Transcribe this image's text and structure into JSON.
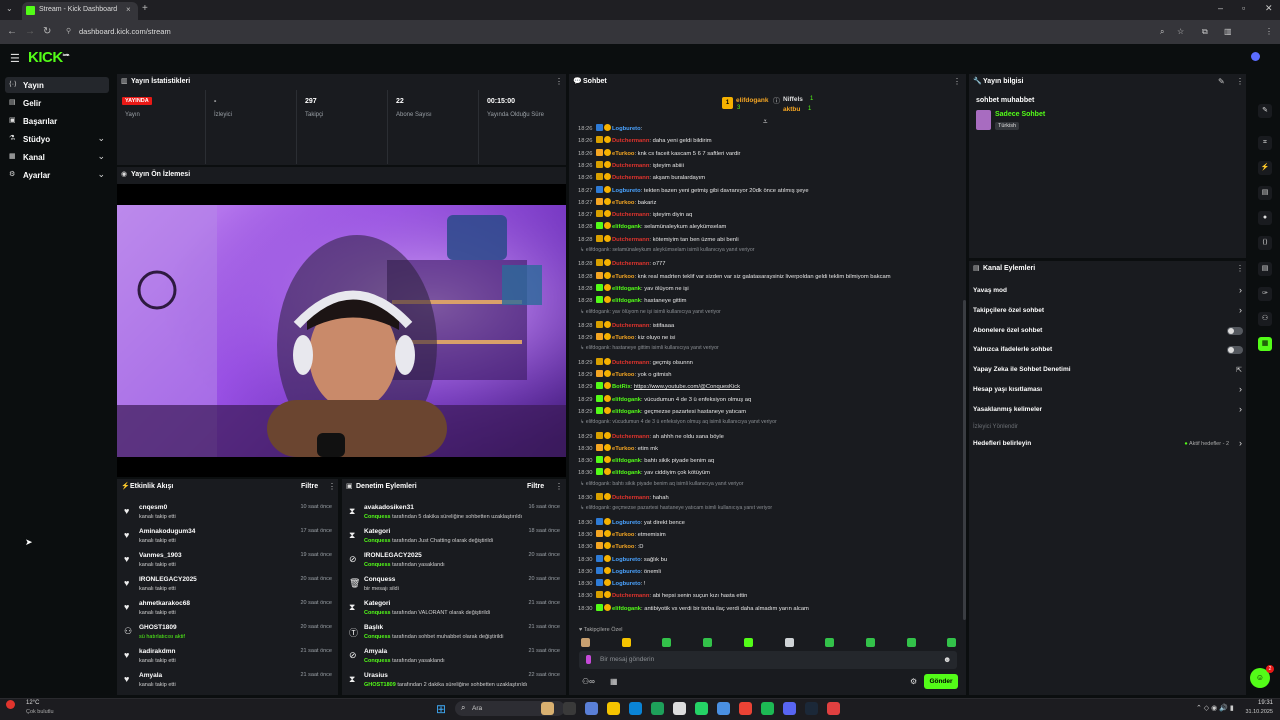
{
  "browser": {
    "tab_title": "Stream - Kick Dashboard",
    "url": "dashboard.kick.com/stream"
  },
  "logo": "KICK",
  "sidebar": {
    "items": [
      {
        "label": "Yayın",
        "icon": "broadcast-icon",
        "active": true,
        "chevron": false
      },
      {
        "label": "Gelir",
        "icon": "revenue-icon",
        "active": false,
        "chevron": false
      },
      {
        "label": "Başarılar",
        "icon": "achievements-icon",
        "active": false,
        "chevron": false
      },
      {
        "label": "Stüdyo",
        "icon": "studio-icon",
        "active": false,
        "chevron": true
      },
      {
        "label": "Kanal",
        "icon": "channel-icon",
        "active": false,
        "chevron": true
      },
      {
        "label": "Ayarlar",
        "icon": "settings-icon",
        "active": false,
        "chevron": true
      }
    ]
  },
  "stats": {
    "title": "Yayın İstatistikleri",
    "live_badge": "YAYINDA",
    "items": [
      {
        "value": "",
        "label": "Yayın"
      },
      {
        "value": "-",
        "label": "İzleyici"
      },
      {
        "value": "297",
        "label": "Takipçi"
      },
      {
        "value": "22",
        "label": "Abone Sayısı"
      },
      {
        "value": "00:15:00",
        "label": "Yayında Olduğu Süre"
      }
    ]
  },
  "preview": {
    "title": "Yayın Ön İzlemesi"
  },
  "activity": {
    "title": "Etkinlik Akışı",
    "filter": "Filtre",
    "rows": [
      {
        "icon": "heart-icon",
        "name": "cnqesm0",
        "sub": "kanalı takip etti",
        "time": "10 saat önce"
      },
      {
        "icon": "heart-icon",
        "name": "Aminakodugum34",
        "sub": "kanalı takip etti",
        "time": "17 saat önce"
      },
      {
        "icon": "heart-icon",
        "name": "Vanmes_1903",
        "sub": "kanalı takip etti",
        "time": "19 saat önce"
      },
      {
        "icon": "heart-icon",
        "name": "IRONLEGACY2025",
        "sub": "kanalı takip etti",
        "time": "20 saat önce"
      },
      {
        "icon": "heart-icon",
        "name": "ahmetkarakoc68",
        "sub": "kanalı takip etti",
        "time": "20 saat önce"
      },
      {
        "icon": "gift-icon",
        "name": "GHOST1809",
        "sub": "sü hatırlatıcısı aktif",
        "time": "20 saat önce"
      },
      {
        "icon": "heart-icon",
        "name": "kadirakdmn",
        "sub": "kanalı takip etti",
        "time": "21 saat önce"
      },
      {
        "icon": "heart-icon",
        "name": "Amyala",
        "sub": "kanalı takip etti",
        "time": "21 saat önce"
      }
    ]
  },
  "moderation": {
    "title": "Denetim Eylemleri",
    "filter": "Filtre",
    "rows": [
      {
        "icon": "hourglass-icon",
        "name": "avakadosiken31",
        "who": "Conquess",
        "sub": " tarafından 5 dakika süreliğine sohbetten uzaklaştırıldı",
        "time": "16 saat önce"
      },
      {
        "icon": "hourglass-icon",
        "name": "Kategori",
        "who": "Conquess",
        "sub": " tarafından Just Chatting olarak değiştirildi",
        "time": "18 saat önce"
      },
      {
        "icon": "ban-icon",
        "name": "IRONLEGACY2025",
        "who": "Conquess",
        "sub": " tarafından yasaklandı",
        "time": "20 saat önce"
      },
      {
        "icon": "trash-icon",
        "name": "Conquess",
        "who": "",
        "sub": "bir mesajı sildi",
        "time": "20 saat önce"
      },
      {
        "icon": "hourglass-icon",
        "name": "Kategori",
        "who": "Conquess",
        "sub": " tarafından VALORANT olarak değiştirildi",
        "time": "21 saat önce"
      },
      {
        "icon": "title-icon",
        "name": "Başlık",
        "who": "Conquess",
        "sub": " tarafından sohbet muhabbet olarak değiştirildi",
        "time": "21 saat önce"
      },
      {
        "icon": "ban-icon",
        "name": "Amyala",
        "who": "Conquess",
        "sub": " tarafından yasaklandı",
        "time": "21 saat önce"
      },
      {
        "icon": "hourglass-icon",
        "name": "Urasius",
        "who": "GHOST1809",
        "sub": " tarafından 2 dakika süreliğine sohbetten uzaklaştırıldı",
        "time": "22 saat önce"
      }
    ]
  },
  "chat": {
    "title": "Sohbet",
    "leaders": [
      {
        "name": "elifdogank",
        "count": "3"
      },
      {
        "name": "Niffels",
        "count": "1"
      },
      {
        "name": "aktbu",
        "count": "1"
      }
    ],
    "messages": [
      {
        "t": "18:26",
        "u": "Logbureto",
        "c": "#4aa3ff",
        "x": ""
      },
      {
        "t": "18:26",
        "u": "Dutchermann",
        "c": "#e0342d",
        "x": "daha yeni geldi bildirim"
      },
      {
        "t": "18:26",
        "u": "eTurkoo",
        "c": "#f5a623",
        "x": "knk cs faceit kascam 5 6 7 saftleri vardir"
      },
      {
        "t": "18:26",
        "u": "Dutchermann",
        "c": "#e0342d",
        "x": "işteyim abiiii"
      },
      {
        "t": "18:26",
        "u": "Dutchermann",
        "c": "#e0342d",
        "x": "akşam buralardayım"
      },
      {
        "t": "18:27",
        "u": "Logbureto",
        "c": "#4aa3ff",
        "x": "tekten bazen yeni getmiş gibi davranıyor 20dk önce atılmış şeye"
      },
      {
        "t": "18:27",
        "u": "eTurkoo",
        "c": "#f5a623",
        "x": "bakariz"
      },
      {
        "t": "18:27",
        "u": "Dutchermann",
        "c": "#e0342d",
        "x": "işteyim diyin aq"
      },
      {
        "t": "18:28",
        "u": "elifdogank",
        "c": "#53fc18",
        "x": "selamünaleykum aleykümselam"
      },
      {
        "t": "18:28",
        "u": "Dutchermann",
        "c": "#e0342d",
        "x": "kötemiyim tan ben üzme abi benli"
      },
      {
        "reply": "elifdogank: selamünaleykum aleykümselam isimli kullanıcıya yanıt veriyor"
      },
      {
        "t": "18:28",
        "u": "Dutchermann",
        "c": "#e0342d",
        "x": "o777"
      },
      {
        "t": "18:28",
        "u": "eTurkoo",
        "c": "#f5a623",
        "x": "knk real madrten teklif var sizden var siz galatasaraysiniz liverpoldan geldi teklim bilmiyom bakcam"
      },
      {
        "t": "18:28",
        "u": "elifdogank",
        "c": "#53fc18",
        "x": "yav ölüyom ne işi"
      },
      {
        "t": "18:28",
        "u": "elifdogank",
        "c": "#53fc18",
        "x": "hastaneye gittim"
      },
      {
        "reply": "elifdogank: yav ölüyom ne işi isimli kullanıcıya yanıt veriyor"
      },
      {
        "t": "18:28",
        "u": "Dutchermann",
        "c": "#e0342d",
        "x": "istifaaaa"
      },
      {
        "t": "18:29",
        "u": "eTurkoo",
        "c": "#f5a623",
        "x": "kiz oluyo ne isi"
      },
      {
        "reply": "elifdogank: hastaneye gittim isimli kullanıcıya yanıt veriyor"
      },
      {
        "t": "18:29",
        "u": "Dutchermann",
        "c": "#e0342d",
        "x": "geçmiş olsunnn"
      },
      {
        "t": "18:29",
        "u": "eTurkoo",
        "c": "#f5a623",
        "x": "yok o gitmish"
      },
      {
        "t": "18:29",
        "u": "BotRix",
        "c": "#53fc18",
        "x": "https://www.youtube.com/@ConquesKick"
      },
      {
        "t": "18:29",
        "u": "elifdogank",
        "c": "#53fc18",
        "x": "vücudumun 4 de 3 ü enfeksiyon olmuş aq"
      },
      {
        "t": "18:29",
        "u": "elifdogank",
        "c": "#53fc18",
        "x": "geçmezse pazartesi hastaneye yatıcam"
      },
      {
        "reply": "elifdogank: vücudumun 4 de 3 ü enfeksiyon olmuş aq isimli kullanıcıya yanıt veriyor"
      },
      {
        "t": "18:29",
        "u": "Dutchermann",
        "c": "#e0342d",
        "x": "ah ahhh ne oldu sana böyle"
      },
      {
        "t": "18:30",
        "u": "eTurkoo",
        "c": "#f5a623",
        "x": "etim mk"
      },
      {
        "t": "18:30",
        "u": "elifdogank",
        "c": "#53fc18",
        "x": "bahtı sikik piyade benim aq"
      },
      {
        "t": "18:30",
        "u": "elifdogank",
        "c": "#53fc18",
        "x": "yav ciddiyim çok kötüyüm"
      },
      {
        "reply": "elifdogank: bahtı sikik piyade benim aq isimli kullanıcıya yanıt veriyor"
      },
      {
        "t": "18:30",
        "u": "Dutchermann",
        "c": "#e0342d",
        "x": "hahah"
      },
      {
        "reply": "elifdogank: geçmezse pazartesi hastaneye yatıcam isimli kullanıcıya yanıt veriyor"
      },
      {
        "t": "18:30",
        "u": "Logbureto",
        "c": "#4aa3ff",
        "x": "yat direkt bence"
      },
      {
        "t": "18:30",
        "u": "eTurkoo",
        "c": "#f5a623",
        "x": "etmemisim"
      },
      {
        "t": "18:30",
        "u": "eTurkoo",
        "c": "#f5a623",
        "x": ":D"
      },
      {
        "t": "18:30",
        "u": "Logbureto",
        "c": "#4aa3ff",
        "x": "sağlık bu"
      },
      {
        "t": "18:30",
        "u": "Logbureto",
        "c": "#4aa3ff",
        "x": "önemli"
      },
      {
        "t": "18:30",
        "u": "Logbureto",
        "c": "#4aa3ff",
        "x": "!"
      },
      {
        "t": "18:30",
        "u": "Dutchermann",
        "c": "#e0342d",
        "x": "abi hepsi senin suçun kızı hasta ettin"
      },
      {
        "t": "18:30",
        "u": "elifdogank",
        "c": "#53fc18",
        "x": "antibiyotik vs verdi bir torba ilaç verdi daha almadım yarın alcam"
      }
    ],
    "followers_only": "Takipçilere Özel",
    "input_placeholder": "Bir mesaj gönderin",
    "send": "Gönder"
  },
  "stream_info": {
    "title": "Yayın bilgisi",
    "stream_title": "sohbet muhabbet",
    "category": "Sadece Sohbet",
    "tag": "Türkish"
  },
  "channel_actions": {
    "title": "Kanal Eylemleri",
    "items": [
      {
        "label": "Yavaş mod",
        "kind": "chevron"
      },
      {
        "label": "Takipçilere özel sohbet",
        "kind": "chevron"
      },
      {
        "label": "Abonelere özel sohbet",
        "kind": "toggle"
      },
      {
        "label": "Yalnızca ifadelerle sohbet",
        "kind": "toggle"
      },
      {
        "label": "Yapay Zeka ile Sohbet Denetimi",
        "kind": "external"
      },
      {
        "label": "Hesap yaşı kısıtlaması",
        "kind": "chevron"
      },
      {
        "label": "Yasaklanmış kelimeler",
        "kind": "chevron"
      }
    ],
    "viewer_section": "İzleyici Yönlendir",
    "goals": {
      "label": "Hedefleri belirleyin",
      "status": "Aktif hedefler - 2"
    }
  },
  "taskbar": {
    "weather_temp": "12°C",
    "weather_desc": "Çok bulutlu",
    "search": "Ara",
    "time": "19:31",
    "date": "31.10.2025",
    "notif": "2"
  },
  "colors": {
    "accent": "#53fc18",
    "live": "#e91916",
    "panel": "#191b1f",
    "bg": "#0b0e0f"
  }
}
